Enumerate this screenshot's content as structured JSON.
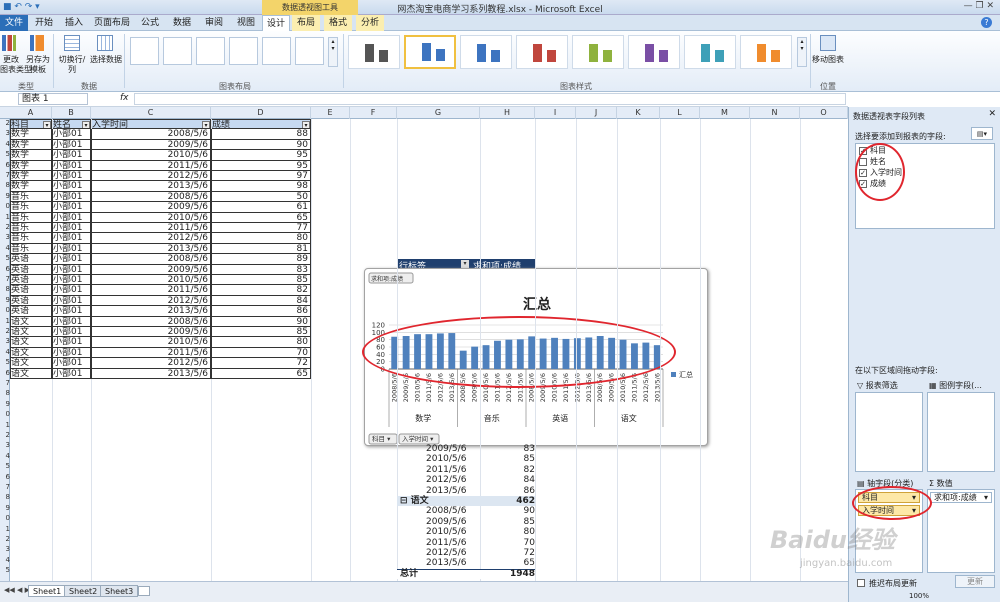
{
  "window": {
    "title": "网杰淘宝电商学习系列教程.xlsx  -  Microsoft Excel",
    "context_tab_group": "数据透视图工具"
  },
  "tabs": [
    "文件",
    "开始",
    "插入",
    "页面布局",
    "公式",
    "数据",
    "审阅",
    "视图",
    "设计",
    "布局",
    "格式",
    "分析"
  ],
  "ribbon": {
    "buttons": {
      "change_type": "更改\n图表类型",
      "save_template": "另存为\n模板",
      "switch_row_col": "切换行/列",
      "select_data": "选择数据",
      "move_chart": "移动图表"
    },
    "groups": {
      "type": "类型",
      "data": "数据",
      "layouts": "图表布局",
      "styles": "图表样式",
      "location": "位置"
    },
    "style_colors": [
      "#555555",
      "#3d74c0",
      "#3d74c0",
      "#c0463d",
      "#8fb23e",
      "#7a4fa5",
      "#3ea0b8",
      "#f08c2e"
    ]
  },
  "formula_bar": {
    "name_box": "图表 1",
    "fx": "fx"
  },
  "columns": [
    "A",
    "B",
    "C",
    "D",
    "E",
    "F",
    "G",
    "H",
    "I",
    "J",
    "K",
    "L",
    "M",
    "N",
    "O"
  ],
  "table": {
    "headers": [
      "科目",
      "姓名",
      "入学时间",
      "成绩"
    ],
    "rows": [
      [
        "数学",
        "小部01",
        "2008/5/6",
        "88"
      ],
      [
        "数学",
        "小部01",
        "2009/5/6",
        "90"
      ],
      [
        "数学",
        "小部01",
        "2010/5/6",
        "95"
      ],
      [
        "数学",
        "小部01",
        "2011/5/6",
        "95"
      ],
      [
        "数学",
        "小部01",
        "2012/5/6",
        "97"
      ],
      [
        "数学",
        "小部01",
        "2013/5/6",
        "98"
      ],
      [
        "音乐",
        "小部01",
        "2008/5/6",
        "50"
      ],
      [
        "音乐",
        "小部01",
        "2009/5/6",
        "61"
      ],
      [
        "音乐",
        "小部01",
        "2010/5/6",
        "65"
      ],
      [
        "音乐",
        "小部01",
        "2011/5/6",
        "77"
      ],
      [
        "音乐",
        "小部01",
        "2012/5/6",
        "80"
      ],
      [
        "音乐",
        "小部01",
        "2013/5/6",
        "81"
      ],
      [
        "英语",
        "小部01",
        "2008/5/6",
        "89"
      ],
      [
        "英语",
        "小部01",
        "2009/5/6",
        "83"
      ],
      [
        "英语",
        "小部01",
        "2010/5/6",
        "85"
      ],
      [
        "英语",
        "小部01",
        "2011/5/6",
        "82"
      ],
      [
        "英语",
        "小部01",
        "2012/5/6",
        "84"
      ],
      [
        "英语",
        "小部01",
        "2013/5/6",
        "86"
      ],
      [
        "语文",
        "小部01",
        "2008/5/6",
        "90"
      ],
      [
        "语文",
        "小部01",
        "2009/5/6",
        "85"
      ],
      [
        "语文",
        "小部01",
        "2010/5/6",
        "80"
      ],
      [
        "语文",
        "小部01",
        "2011/5/6",
        "70"
      ],
      [
        "语文",
        "小部01",
        "2012/5/6",
        "72"
      ],
      [
        "语文",
        "小部01",
        "2013/5/6",
        "65"
      ]
    ]
  },
  "pivot": {
    "header": [
      "行标签",
      "求和项:成绩"
    ],
    "visible_rows": [
      [
        "2009/5/6",
        "83"
      ],
      [
        "2010/5/6",
        "85"
      ],
      [
        "2011/5/6",
        "82"
      ],
      [
        "2012/5/6",
        "84"
      ],
      [
        "2013/5/6",
        "86"
      ],
      [
        "语文",
        "462"
      ],
      [
        "2008/5/6",
        "90"
      ],
      [
        "2009/5/6",
        "85"
      ],
      [
        "2010/5/6",
        "80"
      ],
      [
        "2011/5/6",
        "70"
      ],
      [
        "2012/5/6",
        "72"
      ],
      [
        "2013/5/6",
        "65"
      ],
      [
        "总计",
        "1948"
      ]
    ]
  },
  "chart_data": {
    "type": "bar",
    "title": "汇总",
    "field_button_top": "求和项:成绩",
    "field_buttons_bottom": [
      "科目",
      "入学时间"
    ],
    "legend": "汇总",
    "legend_position": "right",
    "ylim": [
      0,
      120
    ],
    "yticks": [
      0,
      20,
      40,
      60,
      80,
      100,
      120
    ],
    "groups": [
      "数学",
      "音乐",
      "英语",
      "语文"
    ],
    "categories": [
      "2008/5/6",
      "2009/5/6",
      "2010/5/6",
      "2011/5/6",
      "2012/5/6",
      "2013/5/6"
    ],
    "series": [
      {
        "name": "汇总",
        "values": [
          88,
          90,
          95,
          95,
          97,
          98,
          50,
          61,
          65,
          77,
          80,
          81,
          89,
          83,
          85,
          82,
          84,
          86,
          90,
          85,
          80,
          70,
          72,
          65
        ],
        "color": "#4f81bd"
      }
    ],
    "grid": true
  },
  "panel": {
    "title": "数据透视表字段列表",
    "choose_label": "选择要添加到报表的字段:",
    "fields": [
      {
        "name": "科目",
        "checked": true
      },
      {
        "name": "姓名",
        "checked": false
      },
      {
        "name": "入学时间",
        "checked": true
      },
      {
        "name": "成绩",
        "checked": true
      }
    ],
    "drag_label": "在以下区域间拖动字段:",
    "areas": {
      "report_filter": "报表筛选",
      "legend_fields": "图例字段(...",
      "axis_fields": "轴字段(分类)",
      "values": "数值"
    },
    "axis_items": [
      "科目",
      "入学时间"
    ],
    "value_items": [
      "求和项:成绩"
    ],
    "defer_label": "推迟布局更新",
    "update_button": "更新"
  },
  "sheet_tabs": [
    "Sheet1",
    "Sheet2",
    "Sheet3"
  ],
  "status": {
    "zoom": "100%"
  },
  "watermark": "Baidu经验 jingyan.baidu.com"
}
